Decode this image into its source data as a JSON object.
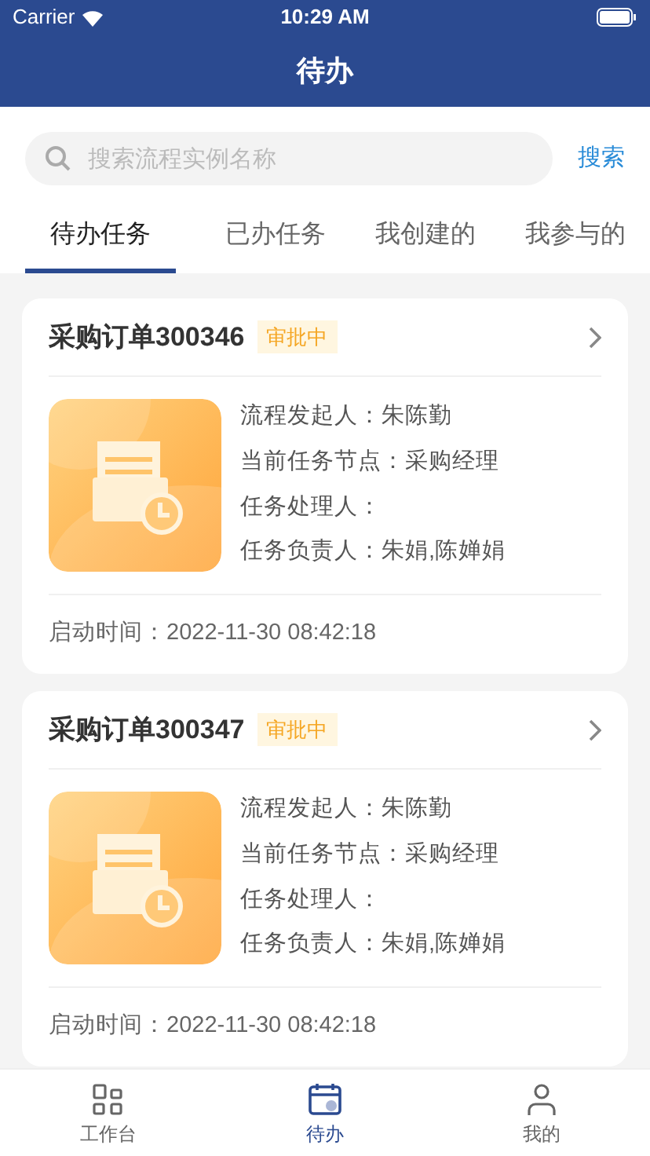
{
  "status_bar": {
    "carrier": "Carrier",
    "time": "10:29 AM"
  },
  "title": "待办",
  "search": {
    "placeholder": "搜索流程实例名称",
    "button": "搜索"
  },
  "tabs": [
    {
      "label": "待办任务",
      "selected": true
    },
    {
      "label": "已办任务",
      "selected": false
    },
    {
      "label": "我创建的",
      "selected": false
    },
    {
      "label": "我参与的",
      "selected": false
    }
  ],
  "tasks": [
    {
      "title": "采购订单300346",
      "status": "审批中",
      "fields": [
        {
          "label": "流程发起人：",
          "value": "朱陈勤"
        },
        {
          "label": "当前任务节点：",
          "value": "采购经理"
        },
        {
          "label": "任务处理人："
        },
        {
          "label": "任务负责人：",
          "value": "朱娟,陈婵娟"
        }
      ],
      "start": "启动时间：2022-11-30 08:42:18"
    },
    {
      "title": "采购订单300347",
      "status": "审批中",
      "fields": [
        {
          "label": "流程发起人：",
          "value": "朱陈勤"
        },
        {
          "label": "当前任务节点：",
          "value": "采购经理"
        },
        {
          "label": "任务处理人："
        },
        {
          "label": "任务负责人：",
          "value": "朱娟,陈婵娟"
        }
      ],
      "start": "启动时间：2022-11-30 08:42:18"
    }
  ],
  "tab_bar": [
    {
      "label": "工作台",
      "kind": "grid",
      "selected": false
    },
    {
      "label": "待办",
      "kind": "calendar",
      "selected": true
    },
    {
      "label": "我的",
      "kind": "person",
      "selected": false
    }
  ]
}
